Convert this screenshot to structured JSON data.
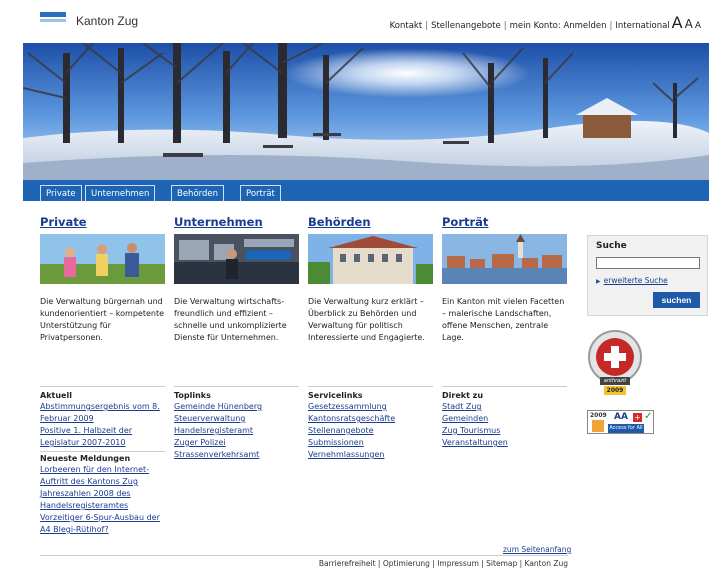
{
  "header": {
    "site_title": "Kanton Zug",
    "meta_nav": {
      "kontakt": "Kontakt",
      "stellen": "Stellenangebote",
      "konto_prefix": "mein Konto:",
      "anmelden": "Anmelden",
      "international": "International",
      "font_large": "A",
      "font_medium": "A",
      "font_small": "A",
      "separator": "|"
    }
  },
  "main_nav": [
    {
      "label": "Private"
    },
    {
      "label": "Unternehmen"
    },
    {
      "label": "Behörden"
    },
    {
      "label": "Porträt"
    }
  ],
  "sections": [
    {
      "title": "Private",
      "text": "Die Verwaltung bürgernah und kundenorientiert – kompetente Unterstützung für Privatpersonen."
    },
    {
      "title": "Unternehmen",
      "text": "Die Verwaltung wirtschafts-freundlich und effizient – schnelle und unkomplizierte Dienste für Unternehmen."
    },
    {
      "title": "Behörden",
      "text": "Die Verwaltung kurz erklärt – Überblick zu Behörden und Verwaltung für politisch Interessierte und Engagierte."
    },
    {
      "title": "Porträt",
      "text": "Ein Kanton mit vielen Facetten – malerische Landschaften, offene Menschen, zentrale Lage."
    }
  ],
  "aktuell": {
    "title": "Aktuell",
    "links": [
      "Abstimmungsergebnis vom 8. Februar 2009",
      "Positive 1. Halbzeit der Legislatur 2007-2010"
    ],
    "news_title": "Neueste Meldungen",
    "news": [
      "Lorbeeren für den Internet-Auftritt des Kantons Zug",
      "Jahreszahlen 2008 des Handelsregisteramtes",
      "Vorzeitiger 6-Spur-Ausbau der A4 Blegi-Rütihof?"
    ]
  },
  "toplinks": {
    "title": "Toplinks",
    "links": [
      "Gemeinde Hünenberg",
      "Steuerverwaltung",
      "Handelsregisteramt",
      "Zuger Polizei",
      "Strassenverkehrsamt"
    ]
  },
  "servicelinks": {
    "title": "Servicelinks",
    "links": [
      "Gesetzessammlung",
      "Kantonsratsgeschäfte",
      "Stellenangebote",
      "Submissionen",
      "Vernehmlassungen"
    ]
  },
  "direkt": {
    "title": "Direkt zu",
    "links": [
      "Stadt Zug",
      "Gemeinden",
      "Zug Tourismus",
      "Veranstaltungen"
    ]
  },
  "search": {
    "title": "Suche",
    "value": "",
    "advanced": "erweiterte Suche",
    "button": "suchen"
  },
  "badges": {
    "anthrazit_year": "2009",
    "anthrazit_label": "anthrazit",
    "access_year": "2009",
    "access_aa": "AA",
    "access_label": "Access for All"
  },
  "footer": {
    "top_link": "zum Seitenanfang",
    "links": [
      "Barrierefreiheit",
      "Optimierung",
      "Impressum",
      "Sitemap",
      "Kanton Zug"
    ]
  },
  "colors": {
    "nav_blue": "#1e64b4",
    "link_blue": "#1a3d8f"
  }
}
